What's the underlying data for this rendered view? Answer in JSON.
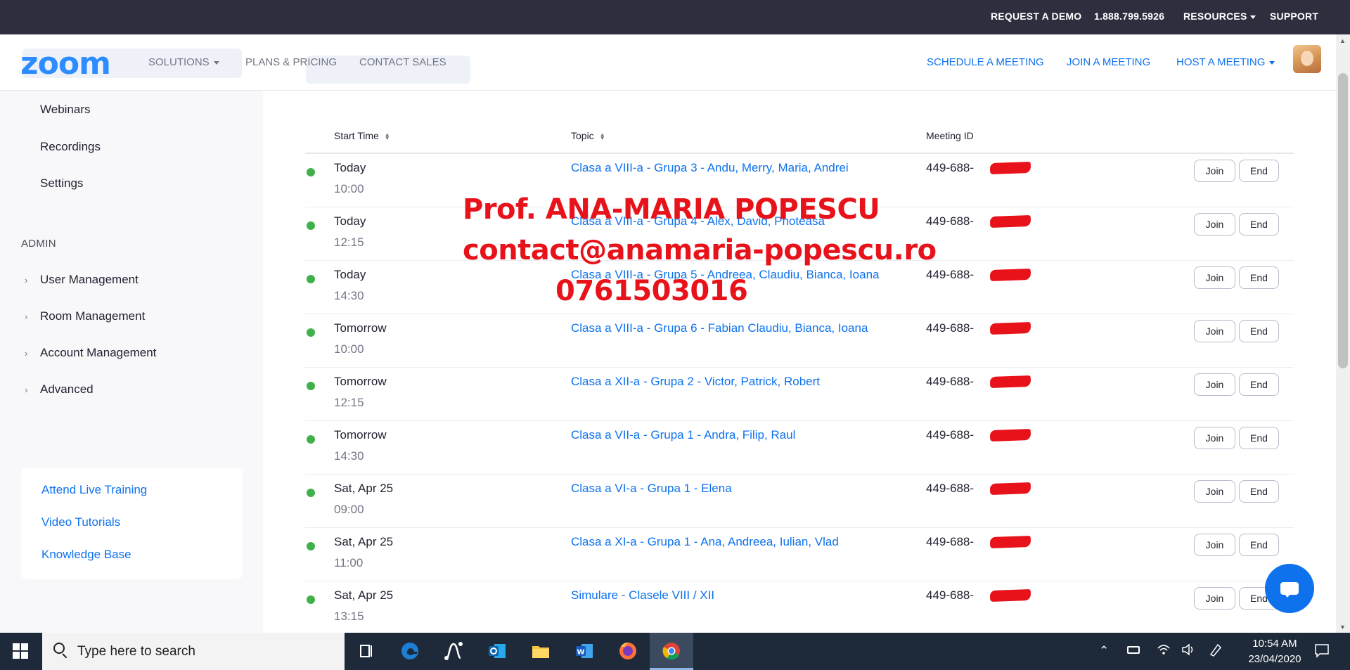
{
  "topbar": {
    "request_demo": "REQUEST A DEMO",
    "phone": "1.888.799.5926",
    "resources": "RESOURCES",
    "support": "SUPPORT"
  },
  "header": {
    "logo": "zoom",
    "solutions": "SOLUTIONS",
    "plans": "PLANS & PRICING",
    "contact_sales": "CONTACT SALES",
    "schedule": "SCHEDULE A MEETING",
    "join": "JOIN A MEETING",
    "host": "HOST A MEETING"
  },
  "sidebar": {
    "items": [
      "Webinars",
      "Recordings",
      "Settings"
    ],
    "admin_label": "ADMIN",
    "admin_items": [
      "User Management",
      "Room Management",
      "Account Management",
      "Advanced"
    ],
    "help_links": [
      "Attend Live Training",
      "Video Tutorials",
      "Knowledge Base"
    ]
  },
  "table": {
    "headers": {
      "start_time": "Start Time",
      "topic": "Topic",
      "meeting_id": "Meeting ID"
    },
    "join_label": "Join",
    "end_label": "End",
    "rows": [
      {
        "day": "Today",
        "time": "10:00",
        "topic": "Clasa a VIII-a - Grupa 3 - Andu, Merry, Maria, Andrei",
        "id": "449-688-"
      },
      {
        "day": "Today",
        "time": "12:15",
        "topic": "Clasa a VIII-a - Grupa 4 - Alex, David, Photeasa",
        "id": "449-688-"
      },
      {
        "day": "Today",
        "time": "14:30",
        "topic": "Clasa a VIII-a - Grupa 5 - Andreea, Claudiu, Bianca, Ioana",
        "id": "449-688-"
      },
      {
        "day": "Tomorrow",
        "time": "10:00",
        "topic": "Clasa a VIII-a - Grupa 6 - Fabian  Claudiu, Bianca, Ioana",
        "id": "449-688-"
      },
      {
        "day": "Tomorrow",
        "time": "12:15",
        "topic": "Clasa a XII-a - Grupa 2 - Victor, Patrick, Robert",
        "id": "449-688-"
      },
      {
        "day": "Tomorrow",
        "time": "14:30",
        "topic": "Clasa a VII-a - Grupa 1 - Andra, Filip, Raul",
        "id": "449-688-"
      },
      {
        "day": "Sat, Apr 25",
        "time": "09:00",
        "topic": "Clasa a VI-a - Grupa 1 - Elena",
        "id": "449-688-"
      },
      {
        "day": "Sat, Apr 25",
        "time": "11:00",
        "topic": "Clasa a XI-a - Grupa 1 - Ana, Andreea, Iulian, Vlad",
        "id": "449-688-"
      },
      {
        "day": "Sat, Apr 25",
        "time": "13:15",
        "topic": "Simulare - Clasele VIII / XII",
        "id": "449-688-"
      }
    ]
  },
  "watermark": {
    "name": "Prof. ANA-MARIA POPESCU",
    "email": "contact@anamaria-popescu.ro",
    "phone": "0761503016"
  },
  "taskbar": {
    "search_placeholder": "Type here to search",
    "time": "10:54 AM",
    "date": "23/04/2020"
  },
  "colors": {
    "accent": "#0e72ed",
    "topbar_bg": "#2d2f3f",
    "status_dot": "#3fb04a",
    "watermark": "#e8121b"
  }
}
